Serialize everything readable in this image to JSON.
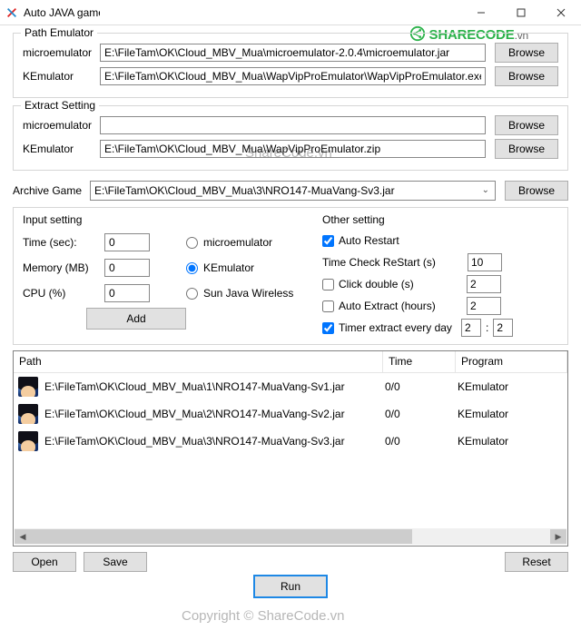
{
  "window": {
    "title": "Auto JAVA game"
  },
  "logo": {
    "main": "SHARECODE",
    "suffix": ".vn"
  },
  "groups": {
    "pathEmu": {
      "title": "Path Emulator",
      "rows": [
        {
          "label": "microemulator",
          "value": "E:\\FileTam\\OK\\Cloud_MBV_Mua\\microemulator-2.0.4\\microemulator.jar",
          "browse": "Browse"
        },
        {
          "label": "KEmulator",
          "value": "E:\\FileTam\\OK\\Cloud_MBV_Mua\\WapVipProEmulator\\WapVipProEmulator.exe",
          "browse": "Browse"
        }
      ]
    },
    "extract": {
      "title": "Extract Setting",
      "rows": [
        {
          "label": "microemulator",
          "value": "",
          "browse": "Browse"
        },
        {
          "label": "KEmulator",
          "value": "E:\\FileTam\\OK\\Cloud_MBV_Mua\\WapVipProEmulator.zip",
          "browse": "Browse"
        }
      ]
    }
  },
  "archive": {
    "label": "Archive Game",
    "value": "E:\\FileTam\\OK\\Cloud_MBV_Mua\\3\\NRO147-MuaVang-Sv3.jar",
    "browse": "Browse"
  },
  "input_setting": {
    "title": "Input setting",
    "time_label": "Time (sec):",
    "time_value": "0",
    "memory_label": "Memory (MB)",
    "memory_value": "0",
    "cpu_label": "CPU (%)",
    "cpu_value": "0",
    "add": "Add"
  },
  "emu_select": {
    "micro": "microemulator",
    "kemu": "KEmulator",
    "sun": "Sun Java Wireless"
  },
  "other": {
    "title": "Other setting",
    "auto_restart": "Auto Restart",
    "time_check_label": "Time Check ReStart (s)",
    "time_check_value": "10",
    "click_double": "Click double (s)",
    "click_double_value": "2",
    "auto_extract": "Auto Extract (hours)",
    "auto_extract_value": "2",
    "timer_extract": "Timer extract every day",
    "timer_h": "2",
    "timer_m": "2"
  },
  "table": {
    "headers": {
      "path": "Path",
      "time": "Time",
      "program": "Program"
    },
    "rows": [
      {
        "path": "E:\\FileTam\\OK\\Cloud_MBV_Mua\\1\\NRO147-MuaVang-Sv1.jar",
        "time": "0/0",
        "program": "KEmulator"
      },
      {
        "path": "E:\\FileTam\\OK\\Cloud_MBV_Mua\\2\\NRO147-MuaVang-Sv2.jar",
        "time": "0/0",
        "program": "KEmulator"
      },
      {
        "path": "E:\\FileTam\\OK\\Cloud_MBV_Mua\\3\\NRO147-MuaVang-Sv3.jar",
        "time": "0/0",
        "program": "KEmulator"
      }
    ]
  },
  "bottom": {
    "open": "Open",
    "save": "Save",
    "reset": "Reset",
    "run": "Run"
  },
  "watermark": {
    "a": "ShareCode.vn",
    "b": "Copyright © ShareCode.vn"
  }
}
